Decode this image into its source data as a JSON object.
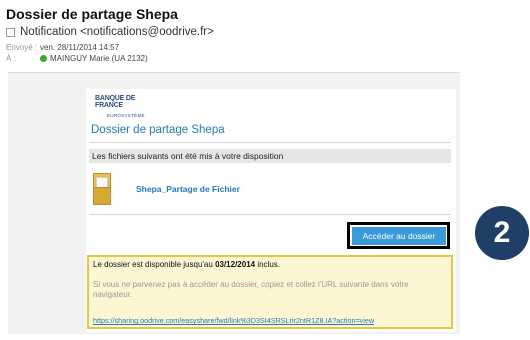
{
  "email": {
    "subject": "Dossier de partage Shepa",
    "sender": "Notification <notifications@oodrive.fr>",
    "sent_label": "Envoyé :",
    "sent_value": "ven. 28/11/2014 14:57",
    "to_label": "À :",
    "to_value": "MAINGUY Marie (UA 2132)"
  },
  "card": {
    "logo_line1": "BANQUE DE FRANCE",
    "logo_line2": "EUROSYSTÈME",
    "title": "Dossier de partage Shepa",
    "info_text": "Les fichiers suivants ont été mis à votre disposition",
    "file_name": "Shepa_Partage de Fichier",
    "access_button": "Accéder au dossier"
  },
  "notice": {
    "line1_prefix": "Le dossier est disponible jusqu'au ",
    "line1_date": "03/12/2014",
    "line1_suffix": " inclus.",
    "line2": "Si vous ne parvenez pas à accéder au dossier, copiez et collez l'URL suivante dans votre navigateur.",
    "url": "https://sharing.oodrive.com/easyshare/fwd/link%3D3SI4SRSLrir2ntR1Z8.IA?action=view"
  },
  "step": {
    "number": "2"
  },
  "colors": {
    "accent_blue": "#1f7bc1",
    "button_blue": "#3b9ad9",
    "notice_bg": "#fdf6d3",
    "notice_border": "#e5c544",
    "step_circle": "#1f3f66"
  }
}
